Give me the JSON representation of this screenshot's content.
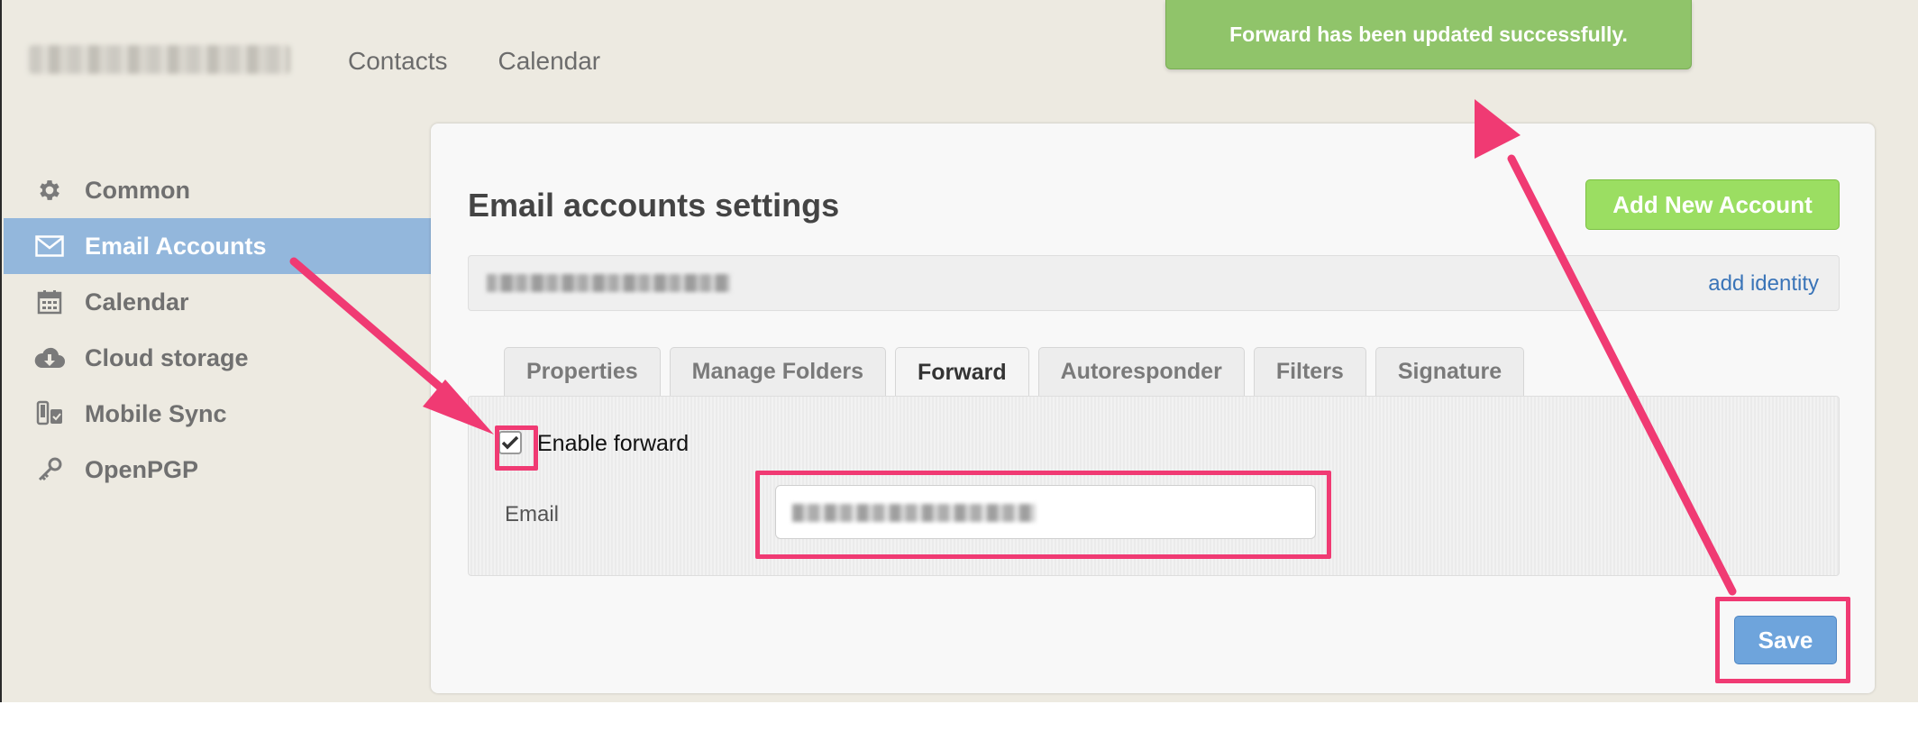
{
  "topnav": {
    "items": [
      "Contacts",
      "Calendar"
    ]
  },
  "sidebar": {
    "items": [
      {
        "label": "Common",
        "icon": "gear-icon"
      },
      {
        "label": "Email Accounts",
        "icon": "envelope-icon",
        "active": true
      },
      {
        "label": "Calendar",
        "icon": "calendar-icon"
      },
      {
        "label": "Cloud storage",
        "icon": "cloud-download-icon"
      },
      {
        "label": "Mobile Sync",
        "icon": "mobile-sync-icon"
      },
      {
        "label": "OpenPGP",
        "icon": "key-icon"
      }
    ]
  },
  "main": {
    "title": "Email accounts settings",
    "add_button": "Add New Account",
    "add_identity": "add identity",
    "tabs": [
      {
        "label": "Properties"
      },
      {
        "label": "Manage Folders"
      },
      {
        "label": "Forward",
        "active": true
      },
      {
        "label": "Autoresponder"
      },
      {
        "label": "Filters"
      },
      {
        "label": "Signature"
      }
    ],
    "forward": {
      "enable_label": "Enable forward",
      "enabled": true,
      "email_label": "Email"
    },
    "save_button": "Save"
  },
  "toast": {
    "message": "Forward has been updated successfully."
  },
  "colors": {
    "accent_blue": "#93b7dc",
    "add_green": "#9bde62",
    "toast_green": "#90c46a",
    "save_blue": "#6ea4dc",
    "annotation_pink": "#f03a73"
  }
}
